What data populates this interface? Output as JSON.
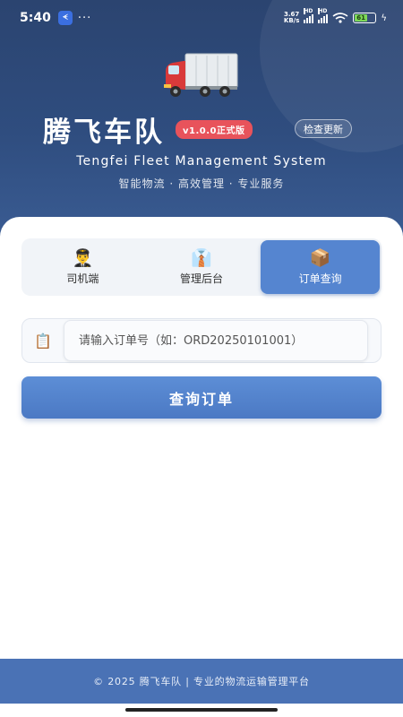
{
  "status_bar": {
    "time": "5:40",
    "app_badge": "ᗛ",
    "dots": "···",
    "net_speed_value": "3.67",
    "net_speed_unit": "KB/s",
    "hd1": "HD",
    "hd2": "HD",
    "battery": "61",
    "battery_level": 0.61
  },
  "header": {
    "title": "腾飞车队",
    "version_badge": "v1.0.0正式版",
    "update_button": "检查更新",
    "subtitle": "Tengfei Fleet Management System",
    "tagline": "智能物流 · 高效管理 · 专业服务"
  },
  "tabs": [
    {
      "label": "司机端",
      "icon": "driver-icon",
      "glyph": "👨‍✈️",
      "active": false
    },
    {
      "label": "管理后台",
      "icon": "manager-icon",
      "glyph": "👔",
      "active": false
    },
    {
      "label": "订单查询",
      "icon": "package-icon",
      "glyph": "📦",
      "active": true
    }
  ],
  "search": {
    "icon": "clipboard-icon",
    "icon_glyph": "📋",
    "placeholder": "请输入订单号（如：ORD20250101001）",
    "value": ""
  },
  "query_button": {
    "label": "查询订单"
  },
  "footer": {
    "text": "© 2025 腾飞车队 | 专业的物流运输管理平台"
  },
  "colors": {
    "header_bg": "#2f4d7f",
    "accent": "#5585d0",
    "badge_red": "#e8535b",
    "footer_bg": "#4a72b5"
  }
}
